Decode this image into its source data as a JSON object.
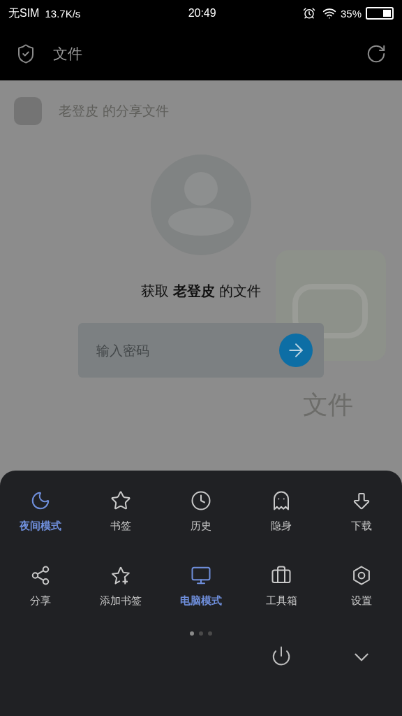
{
  "status_bar": {
    "carrier": "无SIM",
    "speed": "13.7K/s",
    "time": "20:49",
    "battery_text": "35%",
    "battery": {
      "level": 0.35
    }
  },
  "header": {
    "title": "文件"
  },
  "share": {
    "owner_line": "老登皮 的分享文件",
    "prompt": "获取 **老登皮** 的文件",
    "password": {
      "placeholder": "输入密码"
    },
    "app_name": "文件"
  },
  "menu": {
    "items": [
      {
        "label": "夜间模式",
        "kind": "moon",
        "on": true
      },
      {
        "label": "书签",
        "kind": "star",
        "on": false
      },
      {
        "label": "历史",
        "kind": "clock",
        "on": false
      },
      {
        "label": "隐身",
        "kind": "ghost",
        "on": false
      },
      {
        "label": "下载",
        "kind": "download",
        "on": false
      },
      {
        "label": "分享",
        "kind": "share",
        "on": false
      },
      {
        "label": "添加书签",
        "kind": "star-plus",
        "on": false
      },
      {
        "label": "电脑模式",
        "kind": "monitor",
        "on": true
      },
      {
        "label": "工具箱",
        "kind": "briefcase",
        "on": false
      },
      {
        "label": "设置",
        "kind": "settings",
        "on": false
      }
    ],
    "pages": [
      {
        "selected": true
      },
      {
        "selected": false
      },
      {
        "selected": false
      }
    ]
  }
}
